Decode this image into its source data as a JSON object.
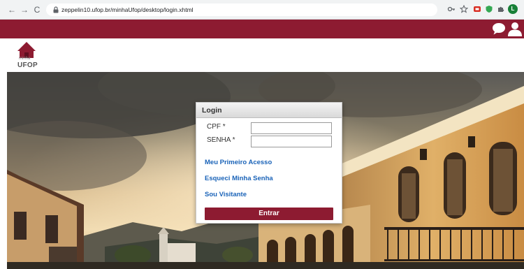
{
  "browser": {
    "url": "zeppelin10.ufop.br/minhaUfop/desktop/login.xhtml",
    "profile_initial": "L"
  },
  "logo": {
    "small_text": "minha",
    "main_text": "UFOP"
  },
  "login": {
    "title": "Login",
    "cpf_label": "CPF *",
    "senha_label": "SENHA *",
    "cpf_value": "",
    "senha_value": "",
    "link_first_access": "Meu Primeiro Acesso",
    "link_forgot": "Esqueci Minha Senha",
    "link_visitor": "Sou Visitante",
    "submit_label": "Entrar"
  },
  "colors": {
    "brand": "#8d1b31",
    "link": "#1a63b8"
  }
}
